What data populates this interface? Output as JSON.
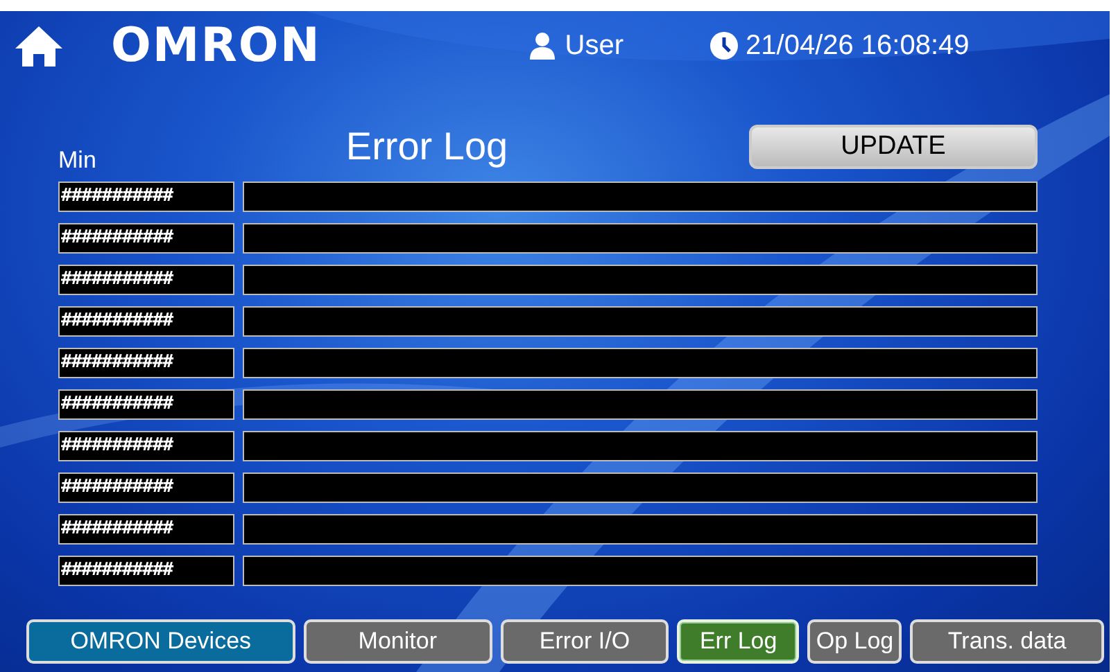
{
  "header": {
    "logo": "OMRON",
    "user": "User",
    "datetime": "21/04/26 16:08:49"
  },
  "title": "Error Log",
  "column_label": "Min",
  "update_button": "UPDATE",
  "rows": [
    {
      "time": "###########"
    },
    {
      "time": "###########"
    },
    {
      "time": "###########"
    },
    {
      "time": "###########"
    },
    {
      "time": "###########"
    },
    {
      "time": "###########"
    },
    {
      "time": "###########"
    },
    {
      "time": "###########"
    },
    {
      "time": "###########"
    },
    {
      "time": "###########"
    }
  ],
  "nav": [
    {
      "label": "OMRON Devices",
      "color": "#0a6c9c",
      "selected": false
    },
    {
      "label": "Monitor",
      "color": "#6b6a6a",
      "selected": false
    },
    {
      "label": "Error I/O",
      "color": "#6b6a6a",
      "selected": false
    },
    {
      "label": "Err Log",
      "color": "#3f7d2a",
      "selected": true
    },
    {
      "label": "Op Log",
      "color": "#6b6a6a",
      "selected": false
    },
    {
      "label": "Trans. data",
      "color": "#6b6a6a",
      "selected": false
    }
  ]
}
